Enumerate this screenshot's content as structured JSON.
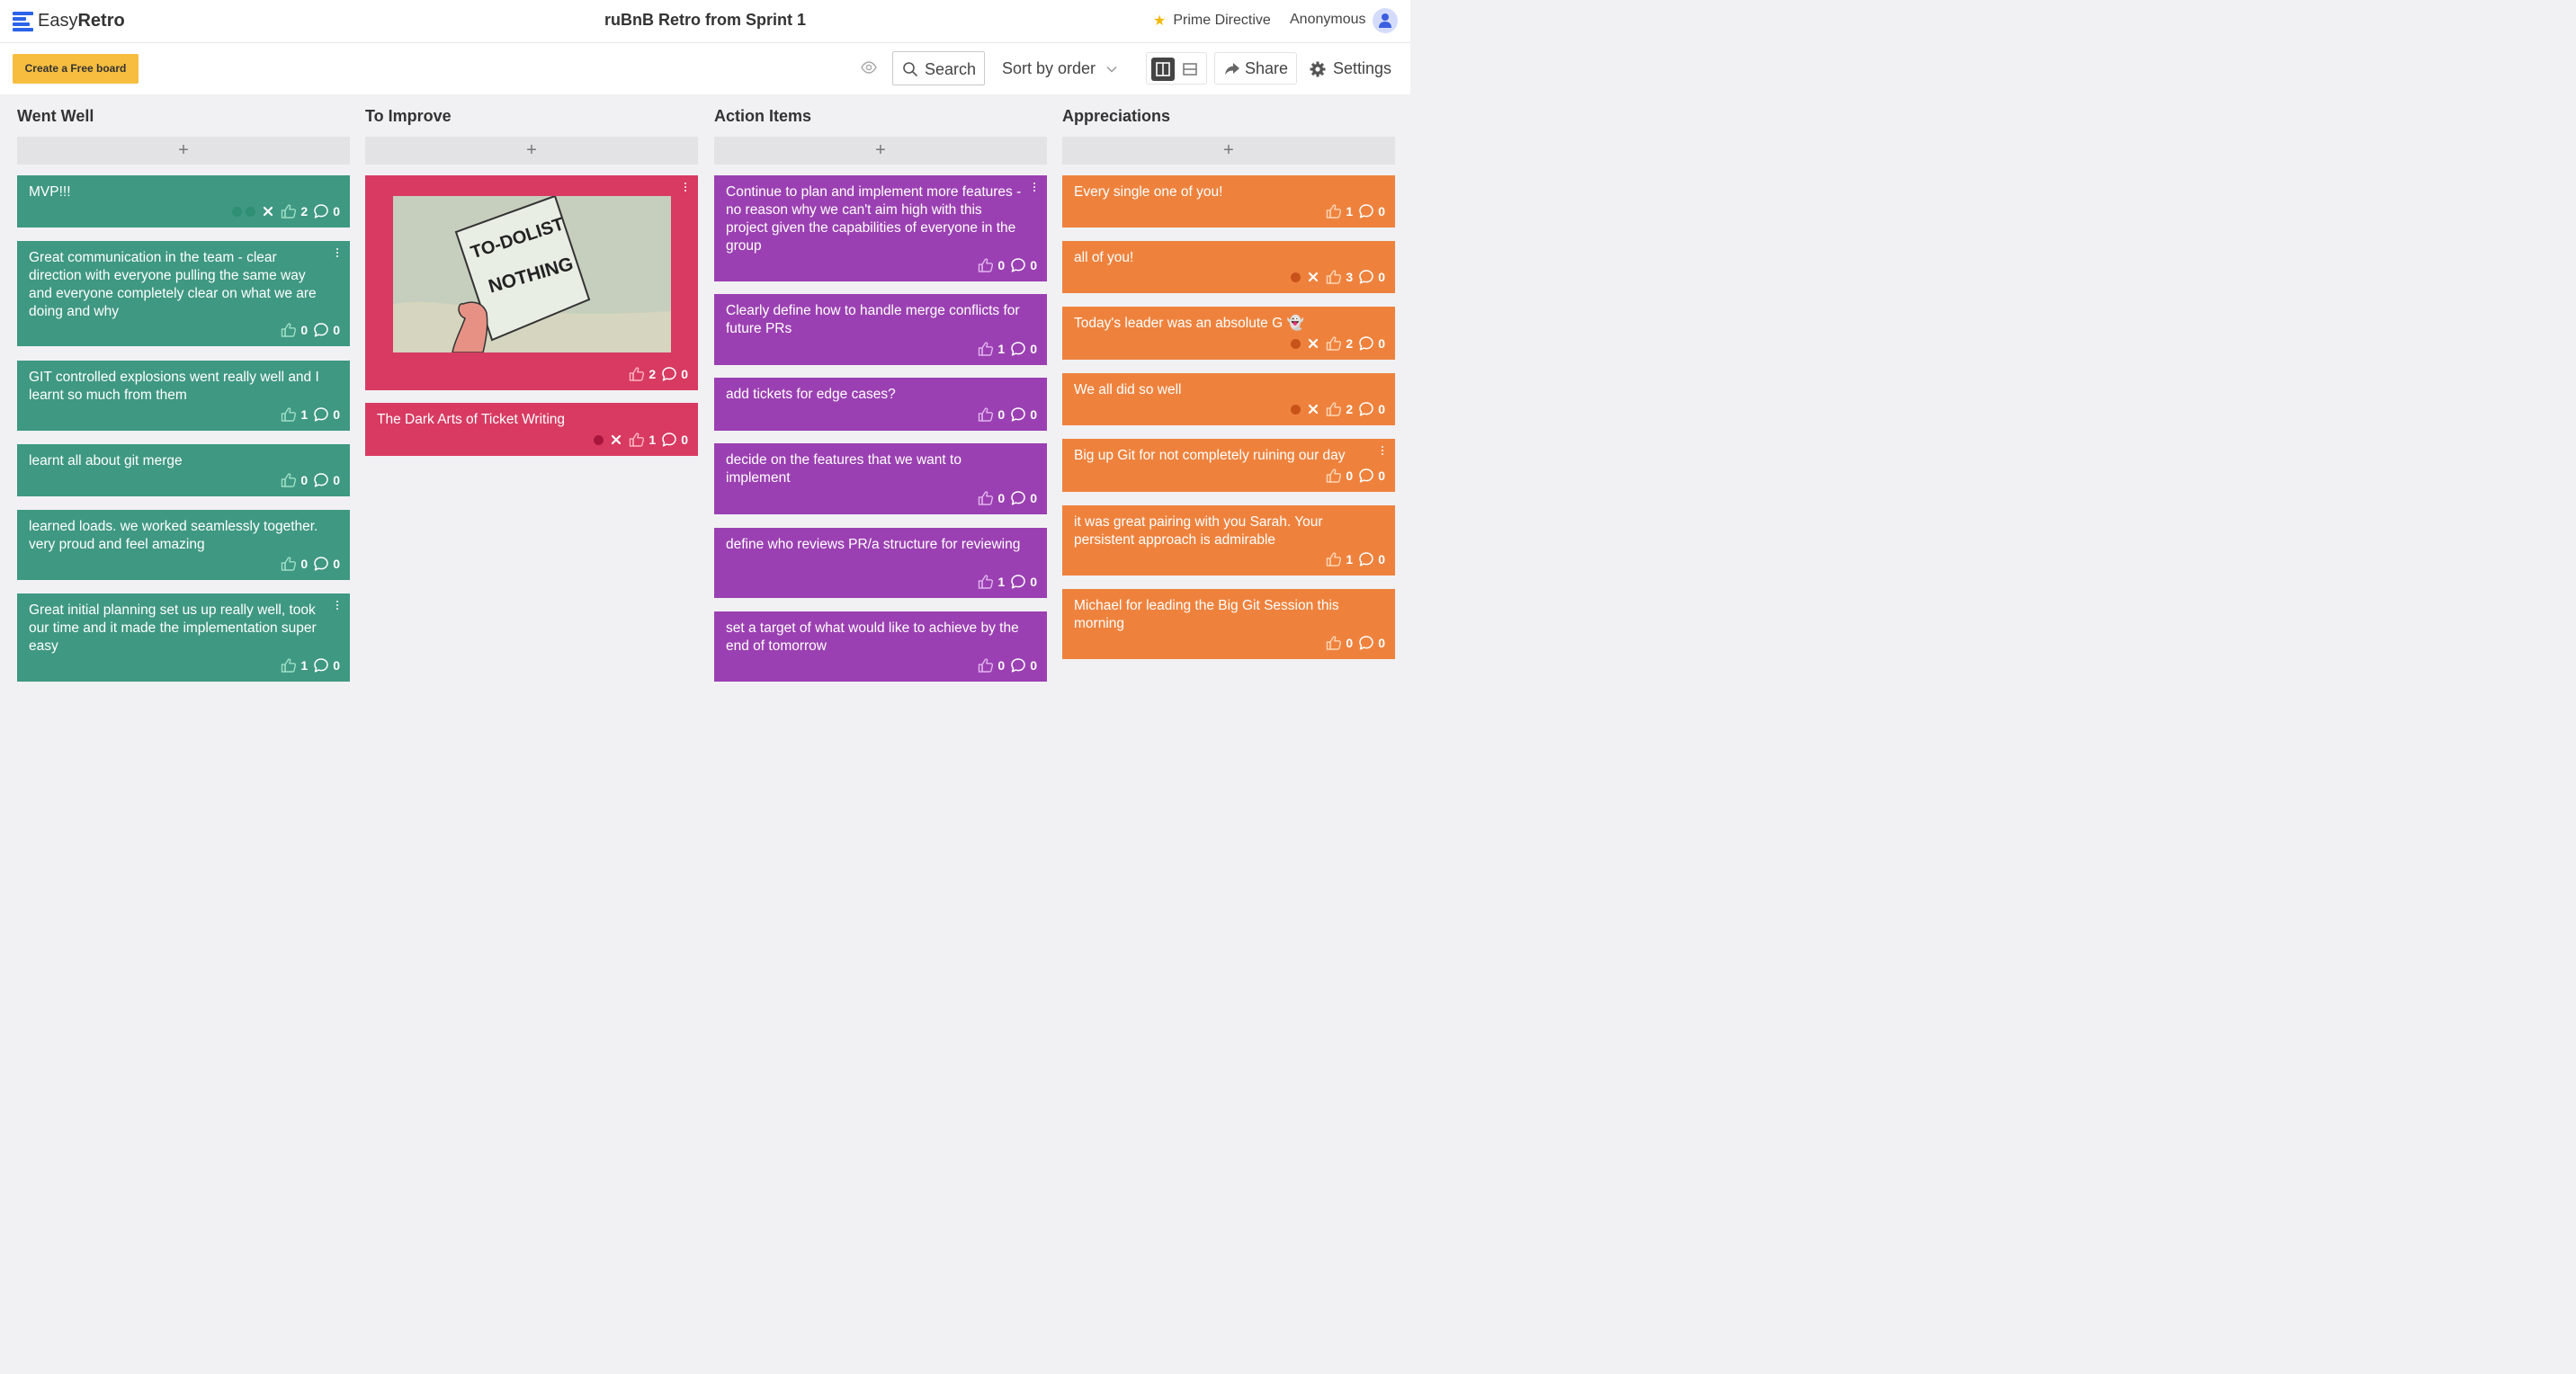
{
  "header": {
    "logo_light": "Easy",
    "logo_bold": "Retro",
    "board_title": "ruBnB Retro from Sprint 1",
    "prime_directive": "Prime Directive",
    "user": "Anonymous"
  },
  "toolbar": {
    "create_board": "Create a Free board",
    "search": "Search",
    "sort": "Sort by order",
    "share": "Share",
    "settings": "Settings"
  },
  "columns": [
    {
      "title": "Went Well",
      "add": "+",
      "cards": [
        {
          "text": "MVP!!!",
          "likes": "2",
          "comments": "0"
        },
        {
          "text": "Great communication in the team - clear direction with everyone pulling the same way and everyone completely clear on what we are doing and why",
          "likes": "0",
          "comments": "0"
        },
        {
          "text": "GIT controlled explosions went really well and I learnt so much from them",
          "likes": "1",
          "comments": "0"
        },
        {
          "text": "learnt all about git merge",
          "likes": "0",
          "comments": "0"
        },
        {
          "text": "learned loads. we worked seamlessly together. very proud and feel amazing",
          "likes": "0",
          "comments": "0"
        },
        {
          "text": "Great initial planning set us up really well, took our time and it made the implementation super easy",
          "likes": "1",
          "comments": "0"
        }
      ]
    },
    {
      "title": "To Improve",
      "add": "+",
      "cards": [
        {
          "gif_line1": "TO-DOLIST",
          "gif_line2": "NOTHING",
          "likes": "2",
          "comments": "0"
        },
        {
          "text": "The Dark Arts of Ticket Writing",
          "likes": "1",
          "comments": "0"
        }
      ]
    },
    {
      "title": "Action Items",
      "add": "+",
      "cards": [
        {
          "text": "Continue to plan and implement more features - no reason why we can't aim high with this project given the capabilities of everyone in the group",
          "likes": "0",
          "comments": "0"
        },
        {
          "text": "Clearly define how to handle merge conflicts for future PRs",
          "likes": "1",
          "comments": "0"
        },
        {
          "text": "add tickets for edge cases?",
          "likes": "0",
          "comments": "0"
        },
        {
          "text": "decide on the features that we want to implement",
          "likes": "0",
          "comments": "0"
        },
        {
          "text": "define who reviews PR/a structure for reviewing",
          "likes": "1",
          "comments": "0"
        },
        {
          "text": "set a target of what would like to achieve by the end of tomorrow",
          "likes": "0",
          "comments": "0"
        }
      ]
    },
    {
      "title": "Appreciations",
      "add": "+",
      "cards": [
        {
          "text": "Every single one of you!",
          "likes": "1",
          "comments": "0"
        },
        {
          "text": "all of you!",
          "likes": "3",
          "comments": "0"
        },
        {
          "text": "Today's leader was an absolute G 👻",
          "likes": "2",
          "comments": "0"
        },
        {
          "text": "We all did so well",
          "likes": "2",
          "comments": "0"
        },
        {
          "text": "Big up Git for not completely ruining our day",
          "likes": "0",
          "comments": "0"
        },
        {
          "text": "it was great pairing with you Sarah. Your persistent approach is admirable",
          "likes": "1",
          "comments": "0"
        },
        {
          "text": "Michael for leading the Big Git Session this morning",
          "likes": "0",
          "comments": "0"
        }
      ]
    }
  ],
  "colors": {
    "went_well": "#3f9882",
    "to_improve": "#d83a62",
    "action_items": "#9b40b2",
    "appreciations": "#ee823d",
    "create_button": "#f6bd3f",
    "brand_blue": "#2b64e8"
  }
}
